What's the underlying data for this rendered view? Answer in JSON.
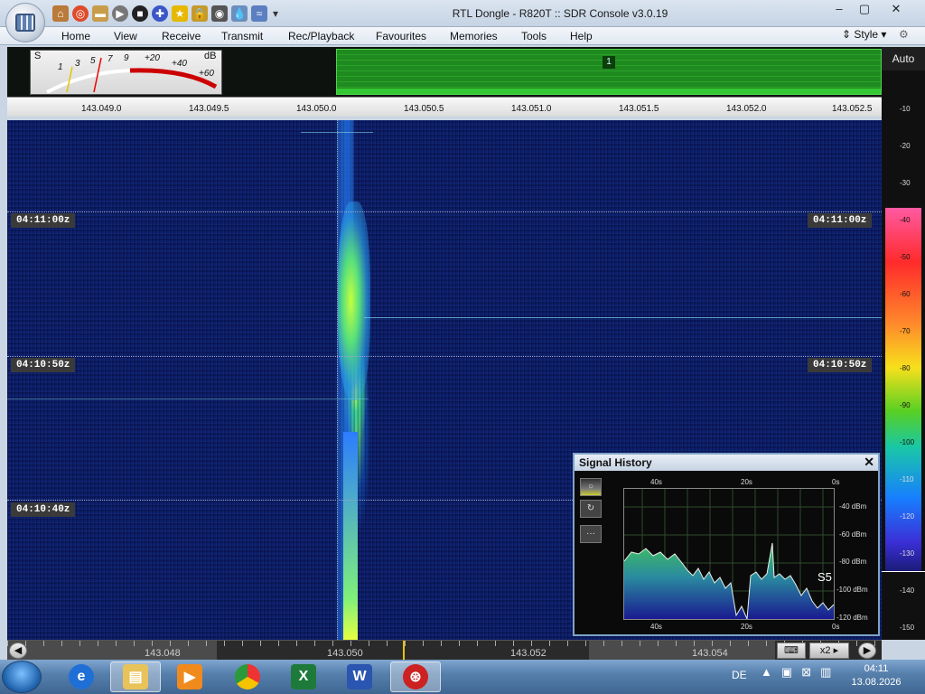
{
  "window": {
    "title": "RTL Dongle - R820T :: SDR Console v3.0.19",
    "controls": [
      "–",
      "▢",
      "✕"
    ]
  },
  "quick_access": [
    "home-icon",
    "lifebuoy-icon",
    "folder-icon",
    "play-icon",
    "stop-icon",
    "add-icon",
    "star-icon",
    "lock-icon",
    "camera-icon",
    "drop-icon",
    "radio-icon",
    "dropdown-icon"
  ],
  "menu": {
    "items": [
      "Home",
      "View",
      "Receive",
      "Transmit",
      "Rec/Playback",
      "Favourites",
      "Memories",
      "Tools",
      "Help"
    ],
    "style_label": "Style"
  },
  "smeter": {
    "s_label": "S",
    "db_label": "dB",
    "scale": [
      "1",
      "3",
      "5",
      "7",
      "9",
      "+20",
      "+40",
      "+60"
    ]
  },
  "spectrum": {
    "vfo_badge": "1"
  },
  "frequency_scale": {
    "ticks": [
      "143.049.0",
      "143.049.5",
      "143.050.0",
      "143.050.5",
      "143.051.0",
      "143.051.5",
      "143.052.0",
      "143.052.5"
    ]
  },
  "waterfall": {
    "time_labels": [
      "04:11:00z",
      "04:10:50z",
      "04:10:40z"
    ]
  },
  "signal_history": {
    "title": "Signal History",
    "close": "✕",
    "time_axis": [
      "40s",
      "20s",
      "0s"
    ],
    "dbm_axis": [
      "-40 dBm",
      "-60 dBm",
      "-80 dBm",
      "-100 dBm",
      "-120 dBm"
    ],
    "s_reading": "S5",
    "buttons": [
      "○",
      "↻",
      "···"
    ]
  },
  "right_bar": {
    "auto_label": "Auto",
    "db_ticks": [
      "-10",
      "-20",
      "-30",
      "-40",
      "-50",
      "-60",
      "-70",
      "-80",
      "-90",
      "-100",
      "-110",
      "-120",
      "-130",
      "-140",
      "-150"
    ]
  },
  "bottom_scale": {
    "ticks": [
      "143.048",
      "143.050",
      "143.052",
      "143.054"
    ],
    "zoom_label": "x2"
  },
  "taskbar": {
    "apps": [
      "internet-explorer-icon",
      "file-explorer-icon",
      "media-player-icon",
      "chrome-icon",
      "excel-icon",
      "word-icon",
      "sdr-console-icon"
    ],
    "language": "DE",
    "time": "04:11",
    "date": "13.08.2026"
  }
}
